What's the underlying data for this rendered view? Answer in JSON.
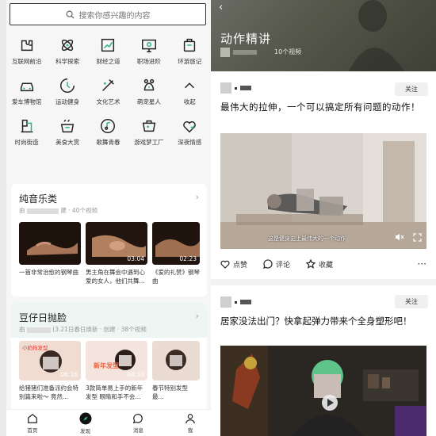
{
  "left": {
    "search": {
      "placeholder": "搜索你感兴趣的内容",
      "icon": "search-icon"
    },
    "categories": [
      {
        "label": "互联网前沿",
        "icon": "puzzle-icon"
      },
      {
        "label": "科学探索",
        "icon": "atom-icon"
      },
      {
        "label": "财经之道",
        "icon": "chart-icon"
      },
      {
        "label": "职场进阶",
        "icon": "monitor-icon"
      },
      {
        "label": "环游旅记",
        "icon": "luggage-icon"
      },
      {
        "label": "爱车博物馆",
        "icon": "car-icon"
      },
      {
        "label": "运动健身",
        "icon": "dumbbell-icon"
      },
      {
        "label": "文化艺术",
        "icon": "palette-icon"
      },
      {
        "label": "萌宠星人",
        "icon": "pet-icon"
      },
      {
        "label": "收起",
        "icon": "collapse-icon"
      },
      {
        "label": "时尚街造",
        "icon": "hanger-icon"
      },
      {
        "label": "美食大赏",
        "icon": "food-icon"
      },
      {
        "label": "歌舞青春",
        "icon": "music-icon"
      },
      {
        "label": "游戏梦工厂",
        "icon": "gamepad-icon"
      },
      {
        "label": "深夜情感",
        "icon": "heart-icon"
      }
    ],
    "card1": {
      "title": "纯音乐类",
      "sub_prefix": "由",
      "sub_suffix": "建 · 40个视频",
      "items": [
        {
          "duration": "",
          "caption": "一首非常治愈的钢琴曲"
        },
        {
          "duration": "03:04",
          "caption": "男主角在舞会中遇到心爱的女人，他们共舞..."
        },
        {
          "duration": "02:23",
          "caption": "《爱的礼赞》钢琴曲"
        }
      ]
    },
    "card2": {
      "title": "豆仔日抛脸",
      "sub_prefix": "由",
      "sub_suffix": "(3.21日春日焕新 · 创建 · 38个视频",
      "items": [
        {
          "duration": "06:16",
          "badge": "小奶狗发型",
          "caption": "给猪猪们准备派约会特别篇来啦～ 竟然..."
        },
        {
          "duration": "04:33",
          "badge": "新年发型",
          "caption": "3款简单易上手的新年发型 眼睛和手不会..."
        },
        {
          "duration": "",
          "badge": "",
          "caption": "春节特别发型 最..."
        }
      ]
    },
    "nav": [
      {
        "label": "首页",
        "icon": "home-icon"
      },
      {
        "label": "发现",
        "icon": "compass-icon"
      },
      {
        "label": "消息",
        "icon": "message-icon"
      },
      {
        "label": "我",
        "icon": "user-icon"
      }
    ]
  },
  "right": {
    "back_icon": "back-arrow-icon",
    "title": "动作精讲",
    "count": "10个视频",
    "posts": [
      {
        "follow": "关注",
        "title": "最伟大的拉伸，一个可以搞定所有问题的动作！",
        "subtitle": "这是健身史上最伟大的一个动作",
        "actions": {
          "like": "点赞",
          "comment": "评论",
          "favorite": "收藏"
        }
      },
      {
        "follow": "关注",
        "title": "居家没法出门？快拿起弹力带来个全身塑形吧！"
      }
    ]
  }
}
